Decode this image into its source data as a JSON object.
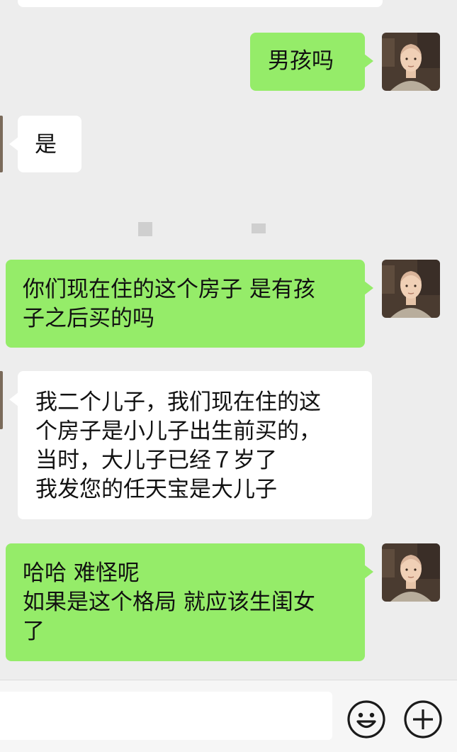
{
  "messages": [
    {
      "id": "m1",
      "side": "right",
      "lines": [
        "男孩吗"
      ]
    },
    {
      "id": "m2",
      "side": "left",
      "lines": [
        "是"
      ]
    },
    {
      "id": "m3",
      "side": "right",
      "lines": [
        "你们现在住的这个房子 是有孩",
        "子之后买的吗"
      ]
    },
    {
      "id": "m4",
      "side": "left",
      "lines": [
        "我二个儿子，我们现在住的这",
        "个房子是小儿子出生前买的，",
        "当时，大儿子已经７岁了",
        "我发您的任天宝是大儿子"
      ]
    },
    {
      "id": "m5",
      "side": "right",
      "lines": [
        "哈哈 难怪呢",
        "如果是这个格局 就应该生闺女",
        "了"
      ]
    }
  ],
  "avatar_icon": "monk-portrait-avatar",
  "input_bar": {
    "emoji_icon": "smiley-face-icon",
    "plus_icon": "plus-circle-icon"
  },
  "colors": {
    "background": "#ededed",
    "my_bubble": "#95ec69",
    "other_bubble": "#ffffff"
  }
}
